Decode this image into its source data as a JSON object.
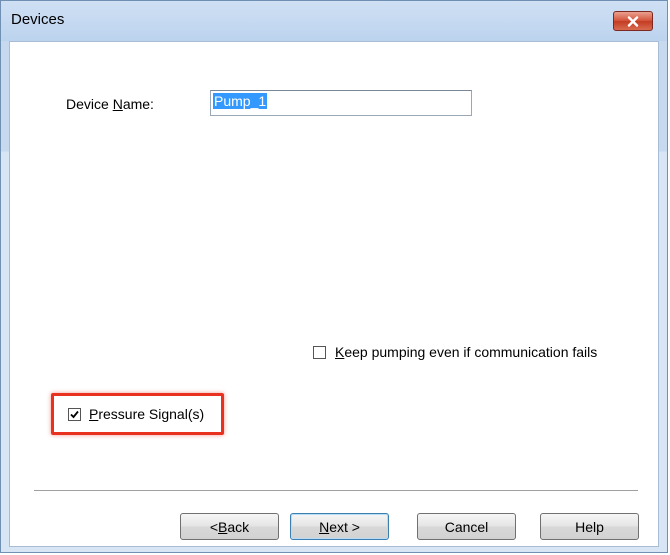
{
  "window": {
    "title": "Devices",
    "accent_color": "#e8321f"
  },
  "form": {
    "device_name_label_pre": "Device ",
    "device_name_label_u": "N",
    "device_name_label_post": "ame:",
    "device_name_value": "Pump_1",
    "keep_pumping_u": "K",
    "keep_pumping_post": "eep pumping even if communication fails",
    "keep_pumping_checked": false,
    "pressure_u": "P",
    "pressure_post": "ressure Signal(s)",
    "pressure_checked": true
  },
  "buttons": {
    "back_pre": "< ",
    "back_u": "B",
    "back_post": "ack",
    "next_u": "N",
    "next_post": "ext >",
    "cancel": "Cancel",
    "help": "Help"
  },
  "icons": {
    "close": "close-icon",
    "check": "checkmark-icon"
  }
}
